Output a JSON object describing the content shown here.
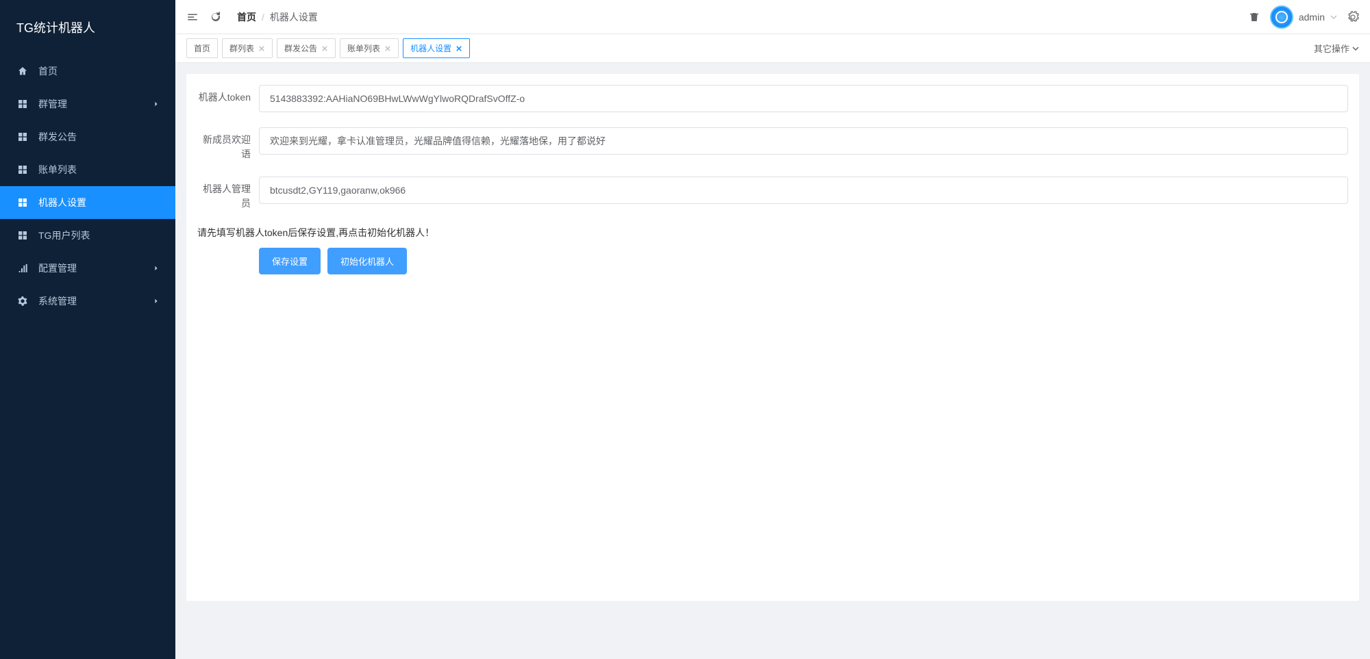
{
  "app_title": "TG统计机器人",
  "sidebar": {
    "items": [
      {
        "label": "首页",
        "icon": "home",
        "active": false,
        "expandable": false
      },
      {
        "label": "群管理",
        "icon": "grid",
        "active": false,
        "expandable": true
      },
      {
        "label": "群发公告",
        "icon": "grid",
        "active": false,
        "expandable": false
      },
      {
        "label": "账单列表",
        "icon": "grid",
        "active": false,
        "expandable": false
      },
      {
        "label": "机器人设置",
        "icon": "grid",
        "active": true,
        "expandable": false
      },
      {
        "label": "TG用户列表",
        "icon": "grid",
        "active": false,
        "expandable": false
      },
      {
        "label": "配置管理",
        "icon": "bars",
        "active": false,
        "expandable": true
      },
      {
        "label": "系统管理",
        "icon": "gear",
        "active": false,
        "expandable": true
      }
    ]
  },
  "header": {
    "breadcrumb": [
      "首页",
      "机器人设置"
    ],
    "user": "admin"
  },
  "tabs": [
    {
      "label": "首页",
      "closable": false,
      "active": false
    },
    {
      "label": "群列表",
      "closable": true,
      "active": false
    },
    {
      "label": "群发公告",
      "closable": true,
      "active": false
    },
    {
      "label": "账单列表",
      "closable": true,
      "active": false
    },
    {
      "label": "机器人设置",
      "closable": true,
      "active": true
    }
  ],
  "tabs_actions_label": "其它操作",
  "form": {
    "token_label": "机器人token",
    "token_value": "5143883392:AAHiaNO69BHwLWwWgYlwoRQDrafSvOffZ-o",
    "welcome_label": "新成员欢迎语",
    "welcome_value": "欢迎来到光耀，拿卡认准管理员，光耀品牌值得信赖，光耀落地保，用了都说好",
    "admins_label": "机器人管理员",
    "admins_value": "btcusdt2,GY119,gaoranw,ok966",
    "help_text": "请先填写机器人token后保存设置,再点击初始化机器人！",
    "save_label": "保存设置",
    "init_label": "初始化机器人"
  }
}
